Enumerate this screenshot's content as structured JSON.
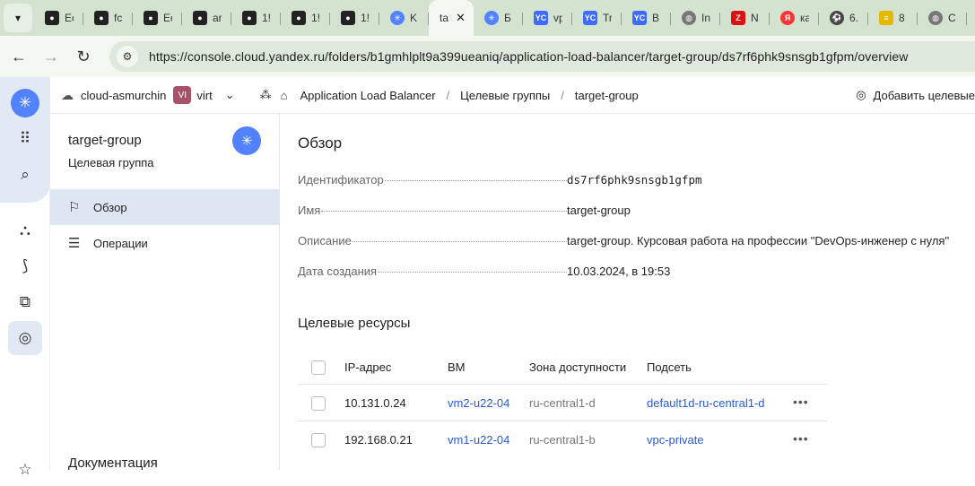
{
  "browser": {
    "tabs": [
      {
        "favicon": "github-icon",
        "label": "Ec"
      },
      {
        "favicon": "github-icon",
        "label": "fc"
      },
      {
        "favicon": "github-icon",
        "label": "Ec"
      },
      {
        "favicon": "github-icon",
        "label": "ar"
      },
      {
        "favicon": "github-icon",
        "label": "1!"
      },
      {
        "favicon": "github-icon",
        "label": "1!"
      },
      {
        "favicon": "github-icon",
        "label": "1!"
      },
      {
        "favicon": "yc-icon",
        "label": "K"
      },
      {
        "favicon": "yc-icon",
        "label": "ta",
        "active": true
      },
      {
        "favicon": "yc-icon",
        "label": "Б"
      },
      {
        "favicon": "yc-badge-icon",
        "label": "vp"
      },
      {
        "favicon": "yc-badge-icon",
        "label": "Tr"
      },
      {
        "favicon": "yc-badge-icon",
        "label": "B"
      },
      {
        "favicon": "globe-icon",
        "label": "In"
      },
      {
        "favicon": "z-icon",
        "label": "N"
      },
      {
        "favicon": "yandex-icon",
        "label": "ка"
      },
      {
        "favicon": "ball-icon",
        "label": "6."
      },
      {
        "favicon": "bird-icon",
        "label": "8"
      },
      {
        "favicon": "globe-icon",
        "label": "C"
      }
    ],
    "url": "https://console.cloud.yandex.ru/folders/b1gmhlplt9a399ueaniq/application-load-balancer/target-group/ds7rf6phk9snsgb1gfpm/overview"
  },
  "header": {
    "cloud": "cloud-asmurchin",
    "folder_badge": "VI",
    "folder": "virt",
    "breadcrumbs": [
      "Application Load Balancer",
      "Целевые группы",
      "target-group"
    ],
    "action": "Добавить целевые"
  },
  "sidebar": {
    "title": "target-group",
    "subtitle": "Целевая группа",
    "items": [
      {
        "label": "Обзор",
        "icon": "flag-icon"
      },
      {
        "label": "Операции",
        "icon": "list-check-icon"
      }
    ],
    "docs": "Документация"
  },
  "overview": {
    "heading": "Обзор",
    "fields": [
      {
        "label": "Идентификатор",
        "value": "ds7rf6phk9snsgb1gfpm"
      },
      {
        "label": "Имя",
        "value": "target-group"
      },
      {
        "label": "Описание",
        "value": "target-group. Курсовая работа на профессии \"DevOps-инженер с нуля\""
      },
      {
        "label": "Дата создания",
        "value": "10.03.2024, в 19:53"
      }
    ]
  },
  "targets": {
    "heading": "Целевые ресурсы",
    "columns": [
      "IP-адрес",
      "ВМ",
      "Зона доступности",
      "Подсеть"
    ],
    "rows": [
      {
        "ip": "10.131.0.24",
        "vm": "vm2-u22-04",
        "zone": "ru-central1-d",
        "subnet": "default1d-ru-central1-d"
      },
      {
        "ip": "192.168.0.21",
        "vm": "vm1-u22-04",
        "zone": "ru-central1-b",
        "subnet": "vpc-private"
      }
    ]
  }
}
